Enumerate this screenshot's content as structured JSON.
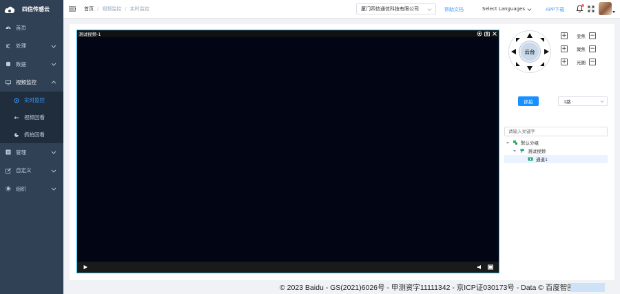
{
  "app": {
    "name": "四信传感云"
  },
  "sidebar": {
    "items": [
      {
        "label": "首页",
        "icon": "dashboard-icon"
      },
      {
        "label": "处理",
        "icon": "process-icon",
        "expandable": true
      },
      {
        "label": "数据",
        "icon": "database-icon",
        "expandable": true
      },
      {
        "label": "视频监控",
        "icon": "monitor-icon",
        "expandable": true,
        "expanded": true,
        "children": [
          {
            "label": "实时监控",
            "icon": "live-icon",
            "active": true
          },
          {
            "label": "视频回看",
            "icon": "playback-icon"
          },
          {
            "label": "抓拍回看",
            "icon": "capture-review-icon"
          }
        ]
      },
      {
        "label": "管理",
        "icon": "manage-icon",
        "expandable": true
      },
      {
        "label": "自定义",
        "icon": "edit-icon",
        "expandable": true
      },
      {
        "label": "组织",
        "icon": "organization-icon",
        "expandable": true
      }
    ]
  },
  "header": {
    "breadcrumb": [
      "首页",
      "视频监控",
      "实时监控"
    ],
    "company": "厦门四信通信科技有限公司",
    "help": "帮助文档",
    "language": "Select Languages",
    "app_download": "APP下载"
  },
  "video": {
    "title": "测试视频-1"
  },
  "ptz": {
    "center_label": "云台",
    "controls": [
      {
        "label": "变焦"
      },
      {
        "label": "聚焦"
      },
      {
        "label": "光圈"
      }
    ]
  },
  "capture": {
    "button": "抓拍",
    "channel_select": "1路"
  },
  "tree": {
    "search_placeholder": "请输入关键字",
    "nodes": [
      {
        "label": "默认分组",
        "level": 0
      },
      {
        "label": "测试视频",
        "level": 1
      },
      {
        "label": "通道1",
        "level": 2,
        "selected": true
      }
    ]
  },
  "footer": {
    "text": "© 2023 Baidu - GS(2021)6026号 - 甲测资字11111342 - 京ICP证030173号 - Data © 百度智图"
  },
  "colors": {
    "sidebar_bg": "#304156",
    "accent": "#409eff",
    "video_border": "#17c1ef",
    "snap_button": "#1890ff"
  }
}
